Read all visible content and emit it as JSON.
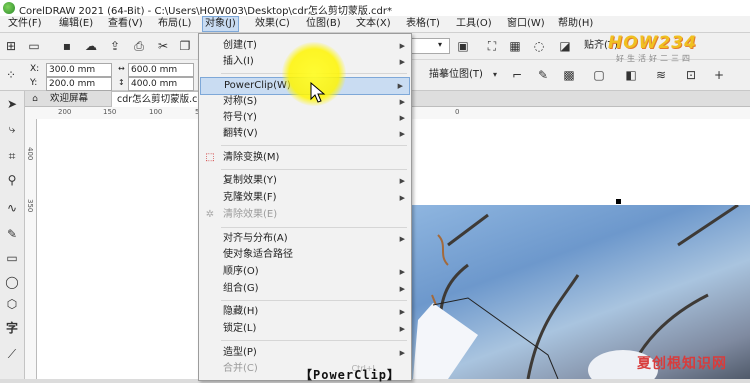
{
  "window": {
    "title": "CorelDRAW 2021 (64-Bit) - C:\\Users\\HOW003\\Desktop\\cdr怎么剪切蒙版.cdr*"
  },
  "menubar": [
    {
      "label": "文件(F)"
    },
    {
      "label": "编辑(E)"
    },
    {
      "label": "查看(V)"
    },
    {
      "label": "布局(L)"
    },
    {
      "label": "对象(J)"
    },
    {
      "label": "效果(C)"
    },
    {
      "label": "位图(B)"
    },
    {
      "label": "文本(X)"
    },
    {
      "label": "表格(T)"
    },
    {
      "label": "工具(O)"
    },
    {
      "label": "窗口(W)"
    },
    {
      "label": "帮助(H)"
    }
  ],
  "toolbar": {
    "snap_label": "贴齐(T)",
    "trace_label": "描摹位图(T)"
  },
  "properties": {
    "x_label": "X:",
    "x_value": "300.0 mm",
    "y_label": "Y:",
    "y_value": "200.0 mm",
    "w_value": "600.0 mm",
    "h_value": "400.0 mm"
  },
  "tabs": [
    {
      "label": "欢迎屏幕"
    },
    {
      "label": "cdr怎么剪切蒙版.cdr*"
    }
  ],
  "ruler": {
    "h_ticks": [
      "200",
      "150",
      "100",
      "50",
      "0"
    ],
    "v_ticks": [
      "400",
      "350"
    ]
  },
  "object_menu": [
    {
      "label": "创建(T)",
      "submenu": true
    },
    {
      "label": "插入(I)",
      "submenu": true
    },
    {
      "label": "PowerClip(W)",
      "submenu": true,
      "highlighted": true
    },
    {
      "label": "对称(S)",
      "submenu": true
    },
    {
      "label": "符号(Y)",
      "submenu": true
    },
    {
      "label": "翻转(V)",
      "submenu": true
    },
    {
      "label": "清除变换(M)"
    },
    {
      "label": "复制效果(Y)",
      "submenu": true
    },
    {
      "label": "克隆效果(F)",
      "submenu": true
    },
    {
      "label": "清除效果(E)",
      "disabled": true
    },
    {
      "label": "对齐与分布(A)",
      "submenu": true
    },
    {
      "label": "使对象适合路径"
    },
    {
      "label": "顺序(O)",
      "submenu": true
    },
    {
      "label": "组合(G)",
      "submenu": true
    },
    {
      "label": "隐藏(H)",
      "submenu": true
    },
    {
      "label": "锁定(L)",
      "submenu": true
    },
    {
      "label": "造型(P)",
      "submenu": true
    },
    {
      "label": "合并(C)",
      "disabled": true,
      "shortcut": "Ctrl+L"
    }
  ],
  "caption": "【PowerClip】",
  "watermark": {
    "logo_text": "HOW234",
    "logo_sub": "好生活好二三四",
    "site_text": "夏创根知识网"
  },
  "colors": {
    "menu_highlight": "#c9dcf2",
    "menu_highlight_border": "#7ea8d8",
    "cursor_spot": "#fff528"
  }
}
